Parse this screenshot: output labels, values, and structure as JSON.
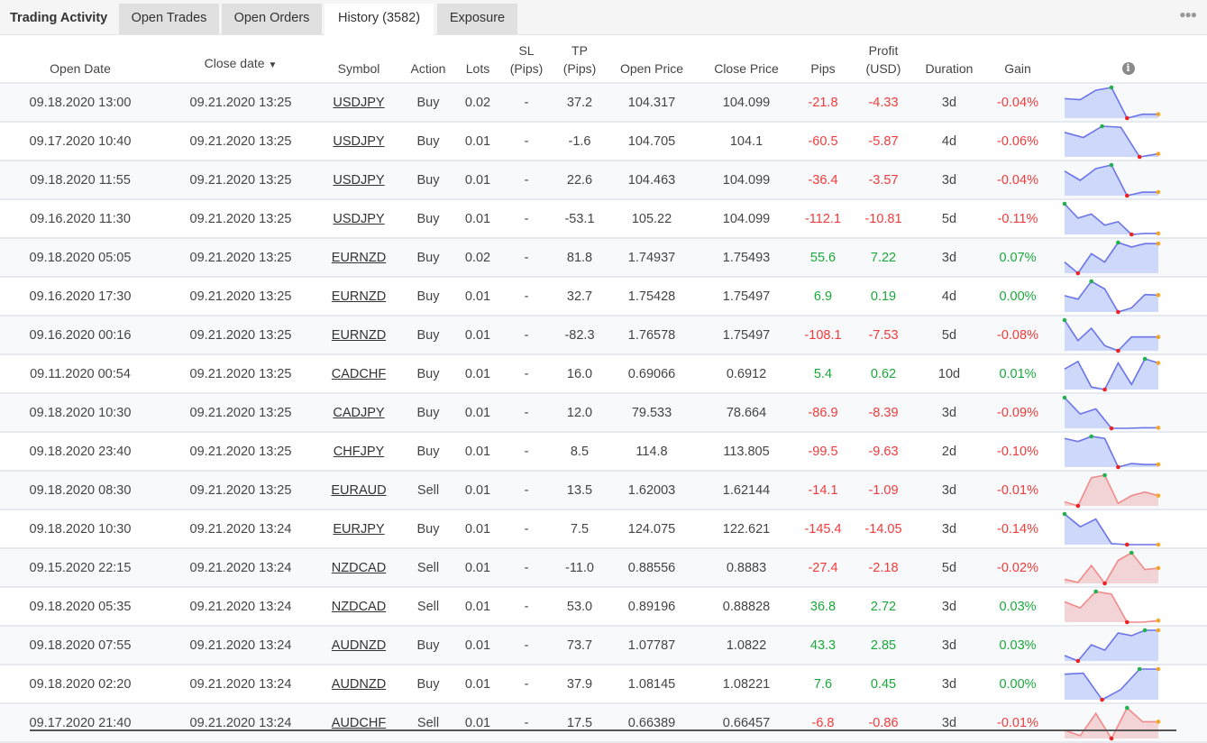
{
  "tabs": {
    "title": "Trading Activity",
    "items": [
      {
        "label": "Open Trades"
      },
      {
        "label": "Open Orders"
      },
      {
        "label": "History (3582)",
        "active": true
      },
      {
        "label": "Exposure"
      }
    ],
    "more_icon": "ellipsis-icon"
  },
  "columns": {
    "open_date": "Open Date",
    "close_date": "Close date",
    "close_date_sort": "▼",
    "symbol": "Symbol",
    "action": "Action",
    "lots": "Lots",
    "sl_1": "SL",
    "sl_2": "(Pips)",
    "tp_1": "TP",
    "tp_2": "(Pips)",
    "open_price": "Open Price",
    "close_price": "Close Price",
    "pips": "Pips",
    "profit_1": "Profit",
    "profit_2": "(USD)",
    "duration": "Duration",
    "gain": "Gain",
    "info_icon": "i"
  },
  "colors": {
    "negative": "#ef3b3b",
    "positive": "#1aa83a",
    "buy_line": "#6b74e8",
    "buy_fill": "#cdd8fb",
    "sell_line": "#f08a8a",
    "sell_fill": "#f2d3d6",
    "max_dot": "#22b14c",
    "min_dot": "#ee2222",
    "end_dot": "#f5a623"
  },
  "rows": [
    {
      "open_date": "09.18.2020 13:00",
      "close_date": "09.21.2020 13:25",
      "symbol": "USDJPY",
      "action": "Buy",
      "lots": "0.02",
      "sl": "-",
      "tp": "37.2",
      "open_price": "104.317",
      "close_price": "104.099",
      "pips": "-21.8",
      "profit": "-4.33",
      "duration": "3d",
      "gain": "-0.04%",
      "spark": [
        40,
        38,
        55,
        60,
        5,
        12,
        12
      ]
    },
    {
      "open_date": "09.17.2020 10:40",
      "close_date": "09.21.2020 13:25",
      "symbol": "USDJPY",
      "action": "Buy",
      "lots": "0.01",
      "sl": "-",
      "tp": "-1.6",
      "open_price": "104.705",
      "close_price": "104.1",
      "pips": "-60.5",
      "profit": "-5.87",
      "duration": "4d",
      "gain": "-0.06%",
      "spark": [
        48,
        38,
        60,
        58,
        0,
        6
      ]
    },
    {
      "open_date": "09.18.2020 11:55",
      "close_date": "09.21.2020 13:25",
      "symbol": "USDJPY",
      "action": "Buy",
      "lots": "0.01",
      "sl": "-",
      "tp": "22.6",
      "open_price": "104.463",
      "close_price": "104.099",
      "pips": "-36.4",
      "profit": "-3.57",
      "duration": "3d",
      "gain": "-0.04%",
      "spark": [
        48,
        30,
        53,
        60,
        0,
        7,
        7
      ]
    },
    {
      "open_date": "09.16.2020 11:30",
      "close_date": "09.21.2020 13:25",
      "symbol": "USDJPY",
      "action": "Buy",
      "lots": "0.01",
      "sl": "-",
      "tp": "-53.1",
      "open_price": "105.22",
      "close_price": "104.099",
      "pips": "-112.1",
      "profit": "-10.81",
      "duration": "5d",
      "gain": "-0.11%",
      "spark": [
        60,
        32,
        40,
        18,
        25,
        0,
        2,
        2
      ]
    },
    {
      "open_date": "09.18.2020 05:05",
      "close_date": "09.21.2020 13:25",
      "symbol": "EURNZD",
      "action": "Buy",
      "lots": "0.02",
      "sl": "-",
      "tp": "81.8",
      "open_price": "1.74937",
      "close_price": "1.75493",
      "pips": "55.6",
      "profit": "7.22",
      "duration": "3d",
      "gain": "0.07%",
      "spark": [
        25,
        5,
        40,
        25,
        60,
        52,
        58,
        58
      ]
    },
    {
      "open_date": "09.16.2020 17:30",
      "close_date": "09.21.2020 13:25",
      "symbol": "EURNZD",
      "action": "Buy",
      "lots": "0.01",
      "sl": "-",
      "tp": "32.7",
      "open_price": "1.75428",
      "close_price": "1.75497",
      "pips": "6.9",
      "profit": "0.19",
      "duration": "4d",
      "gain": "0.00%",
      "spark": [
        32,
        25,
        60,
        45,
        0,
        8,
        34,
        33
      ]
    },
    {
      "open_date": "09.16.2020 00:16",
      "close_date": "09.21.2020 13:25",
      "symbol": "EURNZD",
      "action": "Buy",
      "lots": "0.01",
      "sl": "-",
      "tp": "-82.3",
      "open_price": "1.76578",
      "close_price": "1.75497",
      "pips": "-108.1",
      "profit": "-7.53",
      "duration": "5d",
      "gain": "-0.08%",
      "spark": [
        60,
        20,
        44,
        10,
        0,
        27,
        27,
        27
      ]
    },
    {
      "open_date": "09.11.2020 00:54",
      "close_date": "09.21.2020 13:25",
      "symbol": "CADCHF",
      "action": "Buy",
      "lots": "0.01",
      "sl": "-",
      "tp": "16.0",
      "open_price": "0.69066",
      "close_price": "0.6912",
      "pips": "5.4",
      "profit": "0.62",
      "duration": "10d",
      "gain": "0.01%",
      "spark": [
        40,
        55,
        5,
        0,
        52,
        10,
        60,
        52
      ]
    },
    {
      "open_date": "09.18.2020 10:30",
      "close_date": "09.21.2020 13:25",
      "symbol": "CADJPY",
      "action": "Buy",
      "lots": "0.01",
      "sl": "-",
      "tp": "12.0",
      "open_price": "79.533",
      "close_price": "78.664",
      "pips": "-86.9",
      "profit": "-8.39",
      "duration": "3d",
      "gain": "-0.09%",
      "spark": [
        60,
        28,
        38,
        0,
        0,
        1,
        1
      ]
    },
    {
      "open_date": "09.18.2020 23:40",
      "close_date": "09.21.2020 13:25",
      "symbol": "CHFJPY",
      "action": "Buy",
      "lots": "0.01",
      "sl": "-",
      "tp": "8.5",
      "open_price": "114.8",
      "close_price": "113.805",
      "pips": "-99.5",
      "profit": "-9.63",
      "duration": "2d",
      "gain": "-0.10%",
      "spark": [
        56,
        50,
        60,
        56,
        0,
        7,
        5,
        5
      ]
    },
    {
      "open_date": "09.18.2020 08:30",
      "close_date": "09.21.2020 13:25",
      "symbol": "EURAUD",
      "action": "Sell",
      "lots": "0.01",
      "sl": "-",
      "tp": "13.5",
      "open_price": "1.62003",
      "close_price": "1.62144",
      "pips": "-14.1",
      "profit": "-1.09",
      "duration": "3d",
      "gain": "-0.01%",
      "spark": [
        8,
        0,
        55,
        60,
        5,
        20,
        27,
        20
      ]
    },
    {
      "open_date": "09.18.2020 10:30",
      "close_date": "09.21.2020 13:24",
      "symbol": "EURJPY",
      "action": "Buy",
      "lots": "0.01",
      "sl": "-",
      "tp": "7.5",
      "open_price": "124.075",
      "close_price": "122.621",
      "pips": "-145.4",
      "profit": "-14.05",
      "duration": "3d",
      "gain": "-0.14%",
      "spark": [
        60,
        35,
        50,
        2,
        0,
        0,
        0
      ]
    },
    {
      "open_date": "09.15.2020 22:15",
      "close_date": "09.21.2020 13:24",
      "symbol": "NZDCAD",
      "action": "Sell",
      "lots": "0.01",
      "sl": "-",
      "tp": "-11.0",
      "open_price": "0.88556",
      "close_price": "0.8883",
      "pips": "-27.4",
      "profit": "-2.18",
      "duration": "5d",
      "gain": "-0.02%",
      "spark": [
        8,
        2,
        35,
        0,
        45,
        60,
        27,
        30
      ]
    },
    {
      "open_date": "09.18.2020 05:35",
      "close_date": "09.21.2020 13:24",
      "symbol": "NZDCAD",
      "action": "Sell",
      "lots": "0.01",
      "sl": "-",
      "tp": "53.0",
      "open_price": "0.89196",
      "close_price": "0.88828",
      "pips": "36.8",
      "profit": "2.72",
      "duration": "3d",
      "gain": "0.03%",
      "spark": [
        40,
        28,
        60,
        55,
        0,
        0,
        3
      ]
    },
    {
      "open_date": "09.18.2020 07:55",
      "close_date": "09.21.2020 13:24",
      "symbol": "AUDNZD",
      "action": "Buy",
      "lots": "0.01",
      "sl": "-",
      "tp": "73.7",
      "open_price": "1.07787",
      "close_price": "1.0822",
      "pips": "43.3",
      "profit": "2.85",
      "duration": "3d",
      "gain": "0.03%",
      "spark": [
        10,
        0,
        30,
        20,
        52,
        47,
        57,
        57
      ]
    },
    {
      "open_date": "09.18.2020 02:20",
      "close_date": "09.21.2020 13:24",
      "symbol": "AUDNZD",
      "action": "Buy",
      "lots": "0.01",
      "sl": "-",
      "tp": "37.9",
      "open_price": "1.08145",
      "close_price": "1.08221",
      "pips": "7.6",
      "profit": "0.45",
      "duration": "3d",
      "gain": "0.00%",
      "spark": [
        50,
        52,
        0,
        20,
        60,
        60
      ]
    },
    {
      "open_date": "09.17.2020 21:40",
      "close_date": "09.21.2020 13:24",
      "symbol": "AUDCHF",
      "action": "Sell",
      "lots": "0.01",
      "sl": "-",
      "tp": "17.5",
      "open_price": "0.66389",
      "close_price": "0.66457",
      "pips": "-6.8",
      "profit": "-0.86",
      "duration": "3d",
      "gain": "-0.01%",
      "spark": [
        15,
        5,
        45,
        0,
        55,
        30,
        30
      ]
    }
  ]
}
